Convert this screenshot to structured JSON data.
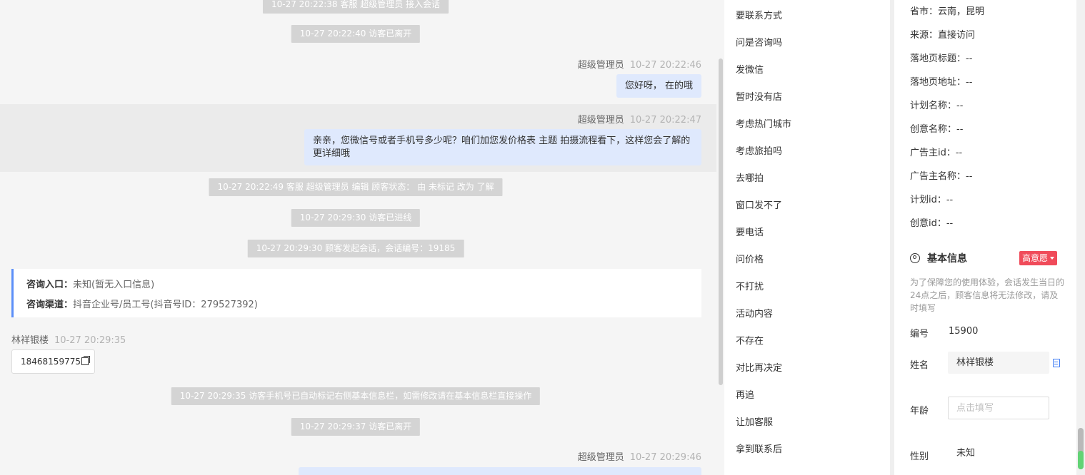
{
  "chat": {
    "system_messages": [
      "10-27 20:22:38 客服 超级管理员 接入会话",
      "10-27 20:22:40 访客已离开",
      "10-27 20:22:49 客服 超级管理员 编辑 顾客状态： 由 未标记 改为 了解",
      "10-27 20:29:30 访客已进线",
      "10-27 20:29:30 顾客发起会话，会话编号：19185",
      "10-27 20:29:35 访客手机号已自动标记右侧基本信息栏，如需修改请在基本信息栏直接操作",
      "10-27 20:29:37 访客已离开"
    ],
    "agent_messages": [
      {
        "sender": "超级管理员",
        "time": "10-27 20:22:46",
        "text": "您好呀，  在的哦"
      },
      {
        "sender": "超级管理员",
        "time": "10-27 20:22:47",
        "text": "亲亲，您微信号或者手机号多少呢？咱们加您发价格表 主题 拍摄流程看下，这样您会了解的更详细哦"
      },
      {
        "sender": "超级管理员",
        "time": "10-27 20:29:46",
        "text": ""
      }
    ],
    "entry_card": {
      "entry_label": "咨询入口：",
      "entry_value": "未知(暂无入口信息)",
      "channel_label": "咨询渠道：",
      "channel_value": "抖音企业号/员工号(抖音号ID：279527392)"
    },
    "visitor": {
      "name": "林祥银楼",
      "time": "10-27 20:29:35",
      "phone": "18468159775"
    }
  },
  "quick_replies": [
    "要联系方式",
    "问是咨询吗",
    "发微信",
    "暂时没有店",
    "考虑热门城市",
    "考虑旅拍吗",
    "去哪拍",
    "窗口发不了",
    "要电话",
    "问价格",
    "不打扰",
    "活动内容",
    "不存在",
    "对比再决定",
    "再追",
    "让加客服",
    "拿到联系后"
  ],
  "info": {
    "source_fields": [
      "省市：云南，昆明",
      "来源：直接访问",
      "落地页标题：--",
      "落地页地址：--",
      "计划名称：--",
      "创意名称：--",
      "广告主id：--",
      "广告主名称：--",
      "计划id：--",
      "创意id：--"
    ],
    "section_title": "基本信息",
    "intent_badge": "高意愿",
    "notice": "为了保障您的使用体验，会话发生当日的24点之后，顾客信息将无法修改，请及时填写",
    "id_label": "编号",
    "id_value": "15900",
    "name_label": "姓名",
    "name_value": "林祥银楼",
    "age_label": "年龄",
    "age_placeholder": "点击填写",
    "gender_label": "性别",
    "gender_value": "未知"
  },
  "colors": {
    "accent_blue": "#5b8ff9",
    "bubble_blue": "#dfe9fd",
    "badge_red": "#f04b5a",
    "system_gray": "#d4d4d4"
  }
}
